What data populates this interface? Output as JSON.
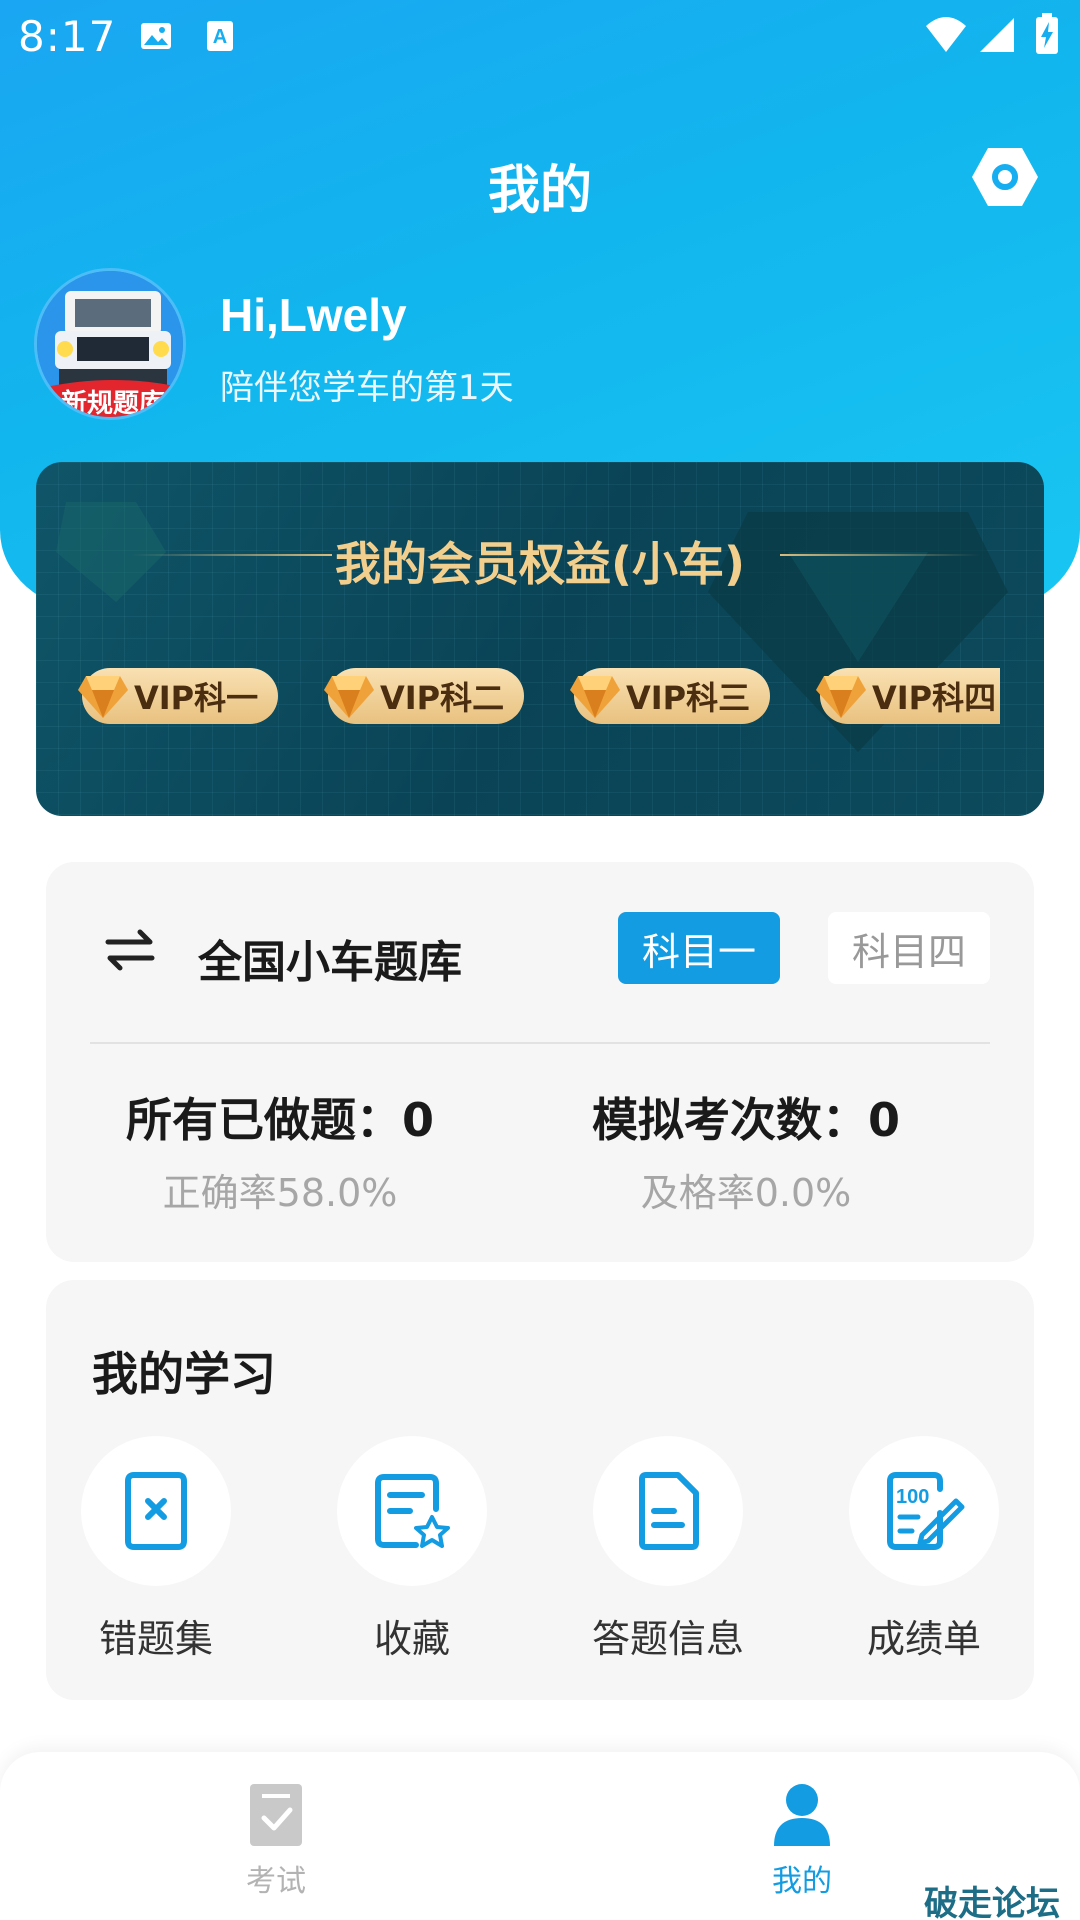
{
  "status_bar": {
    "time": "8:17",
    "icons": [
      "image-icon",
      "a-icon",
      "wifi-icon",
      "signal-icon",
      "battery-icon"
    ]
  },
  "header": {
    "title": "我的",
    "settings_icon": "hexagon-settings-icon"
  },
  "profile": {
    "greeting": "Hi,Lwely",
    "subtitle": "陪伴您学车的第1天",
    "avatar_text": "新规题库"
  },
  "vip": {
    "title": "我的会员权益(小车)",
    "badges": [
      "VIP科一",
      "VIP科二",
      "VIP科三",
      "VIP科四"
    ]
  },
  "question_bank": {
    "name": "全国小车题库",
    "subjects": [
      {
        "label": "科目一",
        "active": true
      },
      {
        "label": "科目四",
        "active": false
      }
    ],
    "stats": [
      {
        "label": "所有已做题：0",
        "sub": "正确率58.0%"
      },
      {
        "label": "模拟考次数：0",
        "sub": "及格率0.0%"
      }
    ]
  },
  "study": {
    "title": "我的学习",
    "items": [
      {
        "label": "错题集",
        "icon": "wrong-book-icon"
      },
      {
        "label": "收藏",
        "icon": "favorite-doc-icon"
      },
      {
        "label": "答题信息",
        "icon": "answer-info-icon"
      },
      {
        "label": "成绩单",
        "icon": "score-sheet-icon"
      }
    ]
  },
  "bottom_nav": {
    "items": [
      {
        "label": "考试",
        "active": false
      },
      {
        "label": "我的",
        "active": true
      }
    ]
  },
  "watermark": "破走论坛",
  "colors": {
    "primary": "#149ce3",
    "vip_gold": "#f3cf8e",
    "vip_bg": "#0a4356"
  }
}
